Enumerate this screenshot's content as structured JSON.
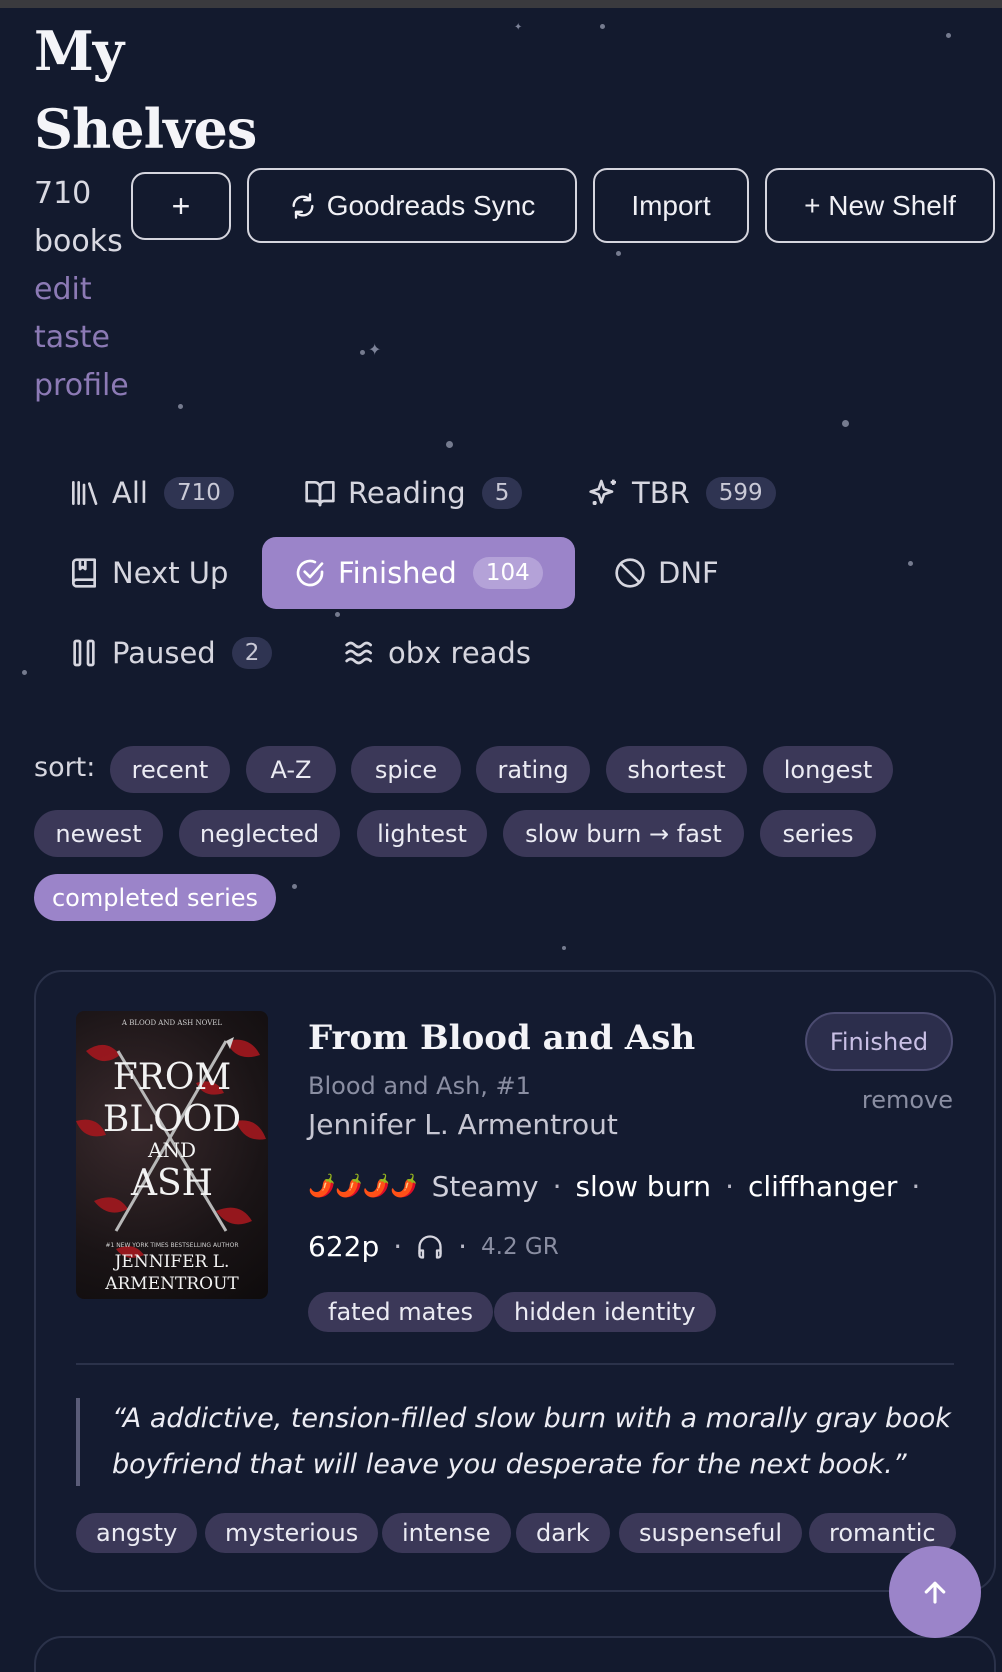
{
  "header": {
    "title_line1": "My",
    "title_line2": "Shelves",
    "count_line1": "710",
    "count_line2": "books",
    "edit_link_line1": "edit",
    "edit_link_line2": "taste",
    "edit_link_line3": "profile",
    "buttons": {
      "add": "+",
      "sync": "Goodreads Sync",
      "import": "Import",
      "new_shelf": "+ New Shelf"
    }
  },
  "tabs": [
    {
      "label": "All",
      "count": "710",
      "icon": "library-icon"
    },
    {
      "label": "Reading",
      "count": "5",
      "icon": "open-book-icon"
    },
    {
      "label": "TBR",
      "count": "599",
      "icon": "sparkles-icon"
    },
    {
      "label": "Next Up",
      "count": "",
      "icon": "bookmark-book-icon"
    },
    {
      "label": "Finished",
      "count": "104",
      "icon": "check-circle-icon",
      "active": true
    },
    {
      "label": "DNF",
      "count": "",
      "icon": "ban-icon"
    },
    {
      "label": "Paused",
      "count": "2",
      "icon": "pause-icon"
    },
    {
      "label": "obx reads",
      "count": "",
      "icon": "waves-icon"
    }
  ],
  "sort": {
    "label": "sort:",
    "options": [
      "recent",
      "A-Z",
      "spice",
      "rating",
      "shortest",
      "longest",
      "newest",
      "neglected",
      "lightest",
      "slow burn → fast",
      "series",
      "completed series"
    ],
    "active": "completed series"
  },
  "book": {
    "title": "From Blood and Ash",
    "series": "Blood and Ash, #1",
    "author": "Jennifer L. Armentrout",
    "status": "Finished",
    "remove": "remove",
    "spice_icons": "🌶️🌶️🌶️🌶️",
    "spice_label": "Steamy",
    "tropes": [
      "slow burn",
      "cliffhanger"
    ],
    "pages": "622p",
    "rating": "4.2 GR",
    "tags": [
      "fated mates",
      "hidden identity"
    ],
    "quote": "“A addictive, tension-filled slow burn with a morally gray book boyfriend that will leave you desperate for the next book.”",
    "moods": [
      "angsty",
      "mysterious",
      "intense",
      "dark",
      "suspenseful",
      "romantic"
    ],
    "cover": {
      "top_text": "A BLOOD AND ASH NOVEL",
      "title_1": "FROM",
      "title_2": "BLOOD",
      "title_3": "AND",
      "title_4": "ASH",
      "tagline": "#1 NEW YORK TIMES BESTSELLING AUTHOR",
      "author_1": "JENNIFER L.",
      "author_2": "ARMENTROUT"
    }
  },
  "colors": {
    "background": "#131a2e",
    "accent": "#9b84c9",
    "chip": "#3b3858",
    "link": "#8c7ab5"
  }
}
